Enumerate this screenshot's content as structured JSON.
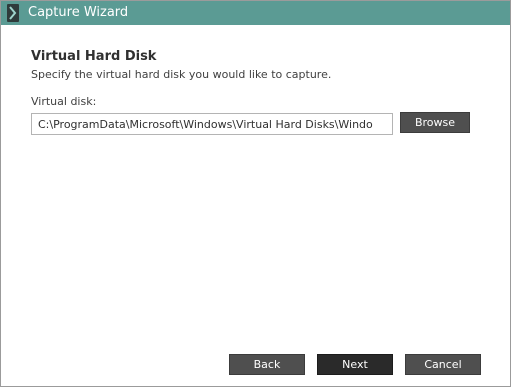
{
  "window": {
    "title": "Capture Wizard",
    "accent_color": "#5b9b94",
    "icon": "wizard-chevron-icon"
  },
  "page": {
    "heading": "Virtual Hard Disk",
    "subheading": "Specify the virtual hard disk you would like to capture."
  },
  "virtual_disk": {
    "label": "Virtual disk:",
    "value": "C:\\ProgramData\\Microsoft\\Windows\\Virtual Hard Disks\\Windo",
    "browse_label": "Browse"
  },
  "footer": {
    "back_label": "Back",
    "next_label": "Next",
    "cancel_label": "Cancel"
  }
}
